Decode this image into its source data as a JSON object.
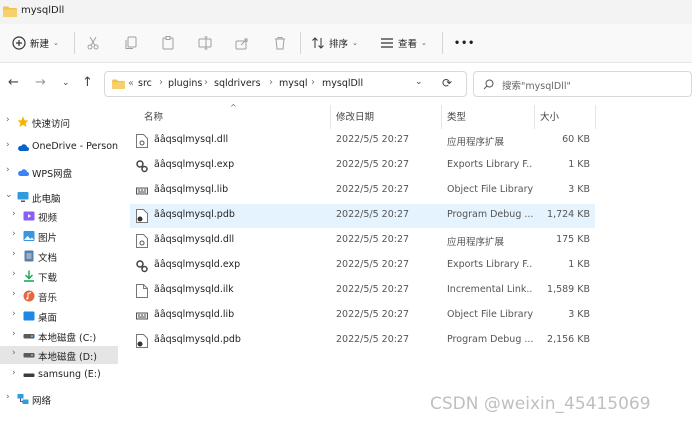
{
  "window": {
    "title": "mysqlDll"
  },
  "toolbar": {
    "new_label": "新建",
    "sort_label": "排序",
    "view_label": "查看",
    "more_label": "•••"
  },
  "nav": {
    "breadcrumb": [
      "src",
      "plugins",
      "sqldrivers",
      "mysql",
      "mysqlDll"
    ],
    "overflow": "«",
    "search_placeholder": "搜索\"mysqlDll\""
  },
  "sidebar": {
    "items": [
      {
        "label": "快速访问",
        "icon": "star-icon"
      },
      {
        "label": "OneDrive - Persona",
        "icon": "cloud-icon"
      },
      {
        "label": "WPS网盘",
        "icon": "cloud-icon"
      },
      {
        "label": "此电脑",
        "icon": "computer-icon"
      },
      {
        "label": "视频",
        "icon": "video-icon"
      },
      {
        "label": "图片",
        "icon": "picture-icon"
      },
      {
        "label": "文档",
        "icon": "document-icon"
      },
      {
        "label": "下载",
        "icon": "download-icon"
      },
      {
        "label": "音乐",
        "icon": "music-icon"
      },
      {
        "label": "桌面",
        "icon": "desktop-icon"
      },
      {
        "label": "本地磁盘 (C:)",
        "icon": "drive-icon"
      },
      {
        "label": "本地磁盘 (D:)",
        "icon": "drive-icon"
      },
      {
        "label": "samsung (E:)",
        "icon": "drive-icon"
      },
      {
        "label": "网络",
        "icon": "network-icon"
      }
    ]
  },
  "columns": {
    "name": "名称",
    "date": "修改日期",
    "type": "类型",
    "size": "大小"
  },
  "files": [
    {
      "name": "ãâqsqlmysql.dll",
      "date": "2022/5/5 20:27",
      "type": "应用程序扩展",
      "size": "60 KB",
      "icon": "dll-file-icon"
    },
    {
      "name": "ãâqsqlmysql.exp",
      "date": "2022/5/5 20:27",
      "type": "Exports Library F...",
      "size": "1 KB",
      "icon": "gear-file-icon"
    },
    {
      "name": "ãâqsqlmysql.lib",
      "date": "2022/5/5 20:27",
      "type": "Object File Library",
      "size": "3 KB",
      "icon": "lib-file-icon"
    },
    {
      "name": "ãâqsqlmysql.pdb",
      "date": "2022/5/5 20:27",
      "type": "Program Debug ...",
      "size": "1,724 KB",
      "icon": "pdb-file-icon"
    },
    {
      "name": "ãâqsqlmysqld.dll",
      "date": "2022/5/5 20:27",
      "type": "应用程序扩展",
      "size": "175 KB",
      "icon": "dll-file-icon"
    },
    {
      "name": "ãâqsqlmysqld.exp",
      "date": "2022/5/5 20:27",
      "type": "Exports Library F...",
      "size": "1 KB",
      "icon": "gear-file-icon"
    },
    {
      "name": "ãâqsqlmysqld.ilk",
      "date": "2022/5/5 20:27",
      "type": "Incremental Link...",
      "size": "1,589 KB",
      "icon": "ilk-file-icon"
    },
    {
      "name": "ãâqsqlmysqld.lib",
      "date": "2022/5/5 20:27",
      "type": "Object File Library",
      "size": "3 KB",
      "icon": "lib-file-icon"
    },
    {
      "name": "ãâqsqlmysqld.pdb",
      "date": "2022/5/5 20:27",
      "type": "Program Debug ...",
      "size": "2,156 KB",
      "icon": "pdb-file-icon"
    }
  ],
  "watermark": "CSDN @weixin_45415069",
  "colors": {
    "folder": "#f2c14e",
    "accent": "#0067c0",
    "selected_row": "#e5f3ff"
  }
}
